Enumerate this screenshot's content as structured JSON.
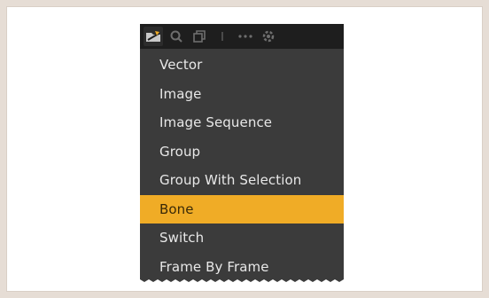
{
  "menu": {
    "toolbar_icons": [
      {
        "name": "new-layer-icon",
        "active": true
      },
      {
        "name": "search-icon"
      },
      {
        "name": "duplicate-icon"
      },
      {
        "name": "separator-icon"
      },
      {
        "name": "more-icon"
      },
      {
        "name": "settings-icon"
      }
    ],
    "items": [
      {
        "label": "Vector"
      },
      {
        "label": "Image"
      },
      {
        "label": "Image Sequence"
      },
      {
        "label": "Group"
      },
      {
        "label": "Group With Selection"
      },
      {
        "label": "Bone",
        "highlighted": true
      },
      {
        "label": "Switch"
      },
      {
        "label": "Frame By Frame"
      }
    ]
  },
  "colors": {
    "menu_bg": "#3b3b3b",
    "toolbar_bg": "#1e1e1e",
    "highlight": "#f0ac26",
    "text": "#e8e8e8"
  }
}
